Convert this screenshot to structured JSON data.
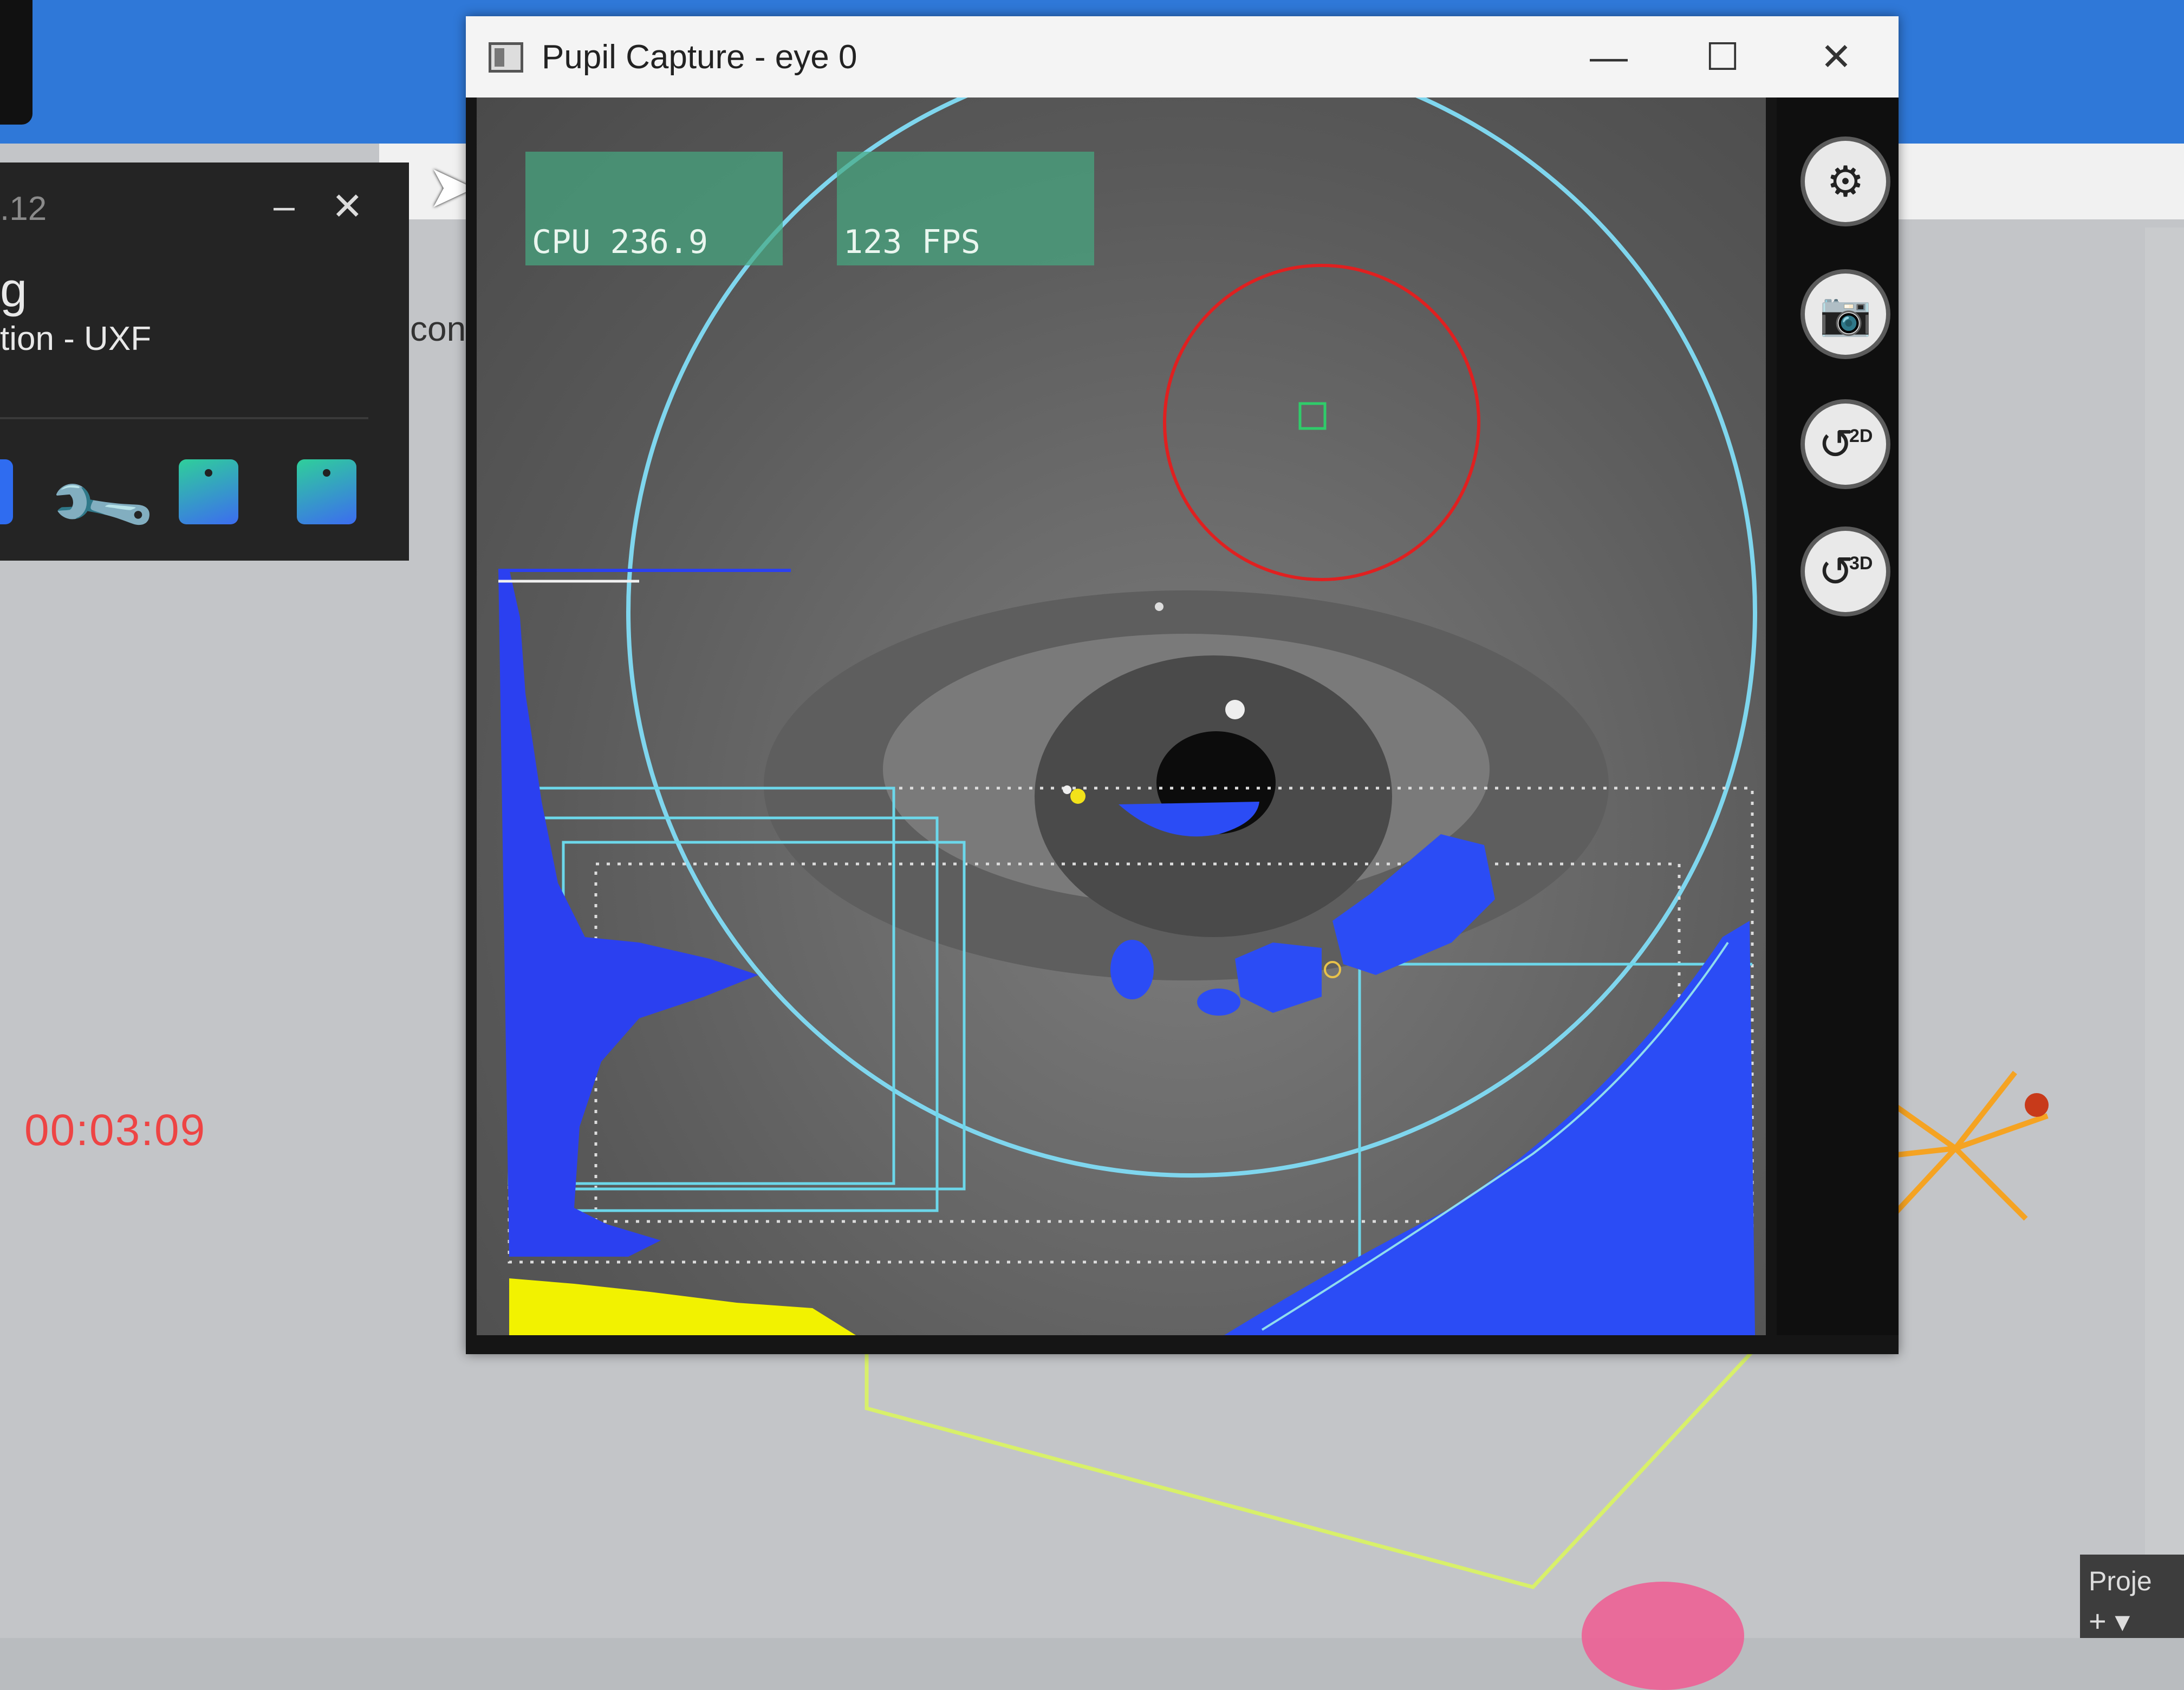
{
  "window": {
    "title": "Pupil Capture - eye 0",
    "minimize_icon": "minimize-icon",
    "maximize_icon": "maximize-icon",
    "close_icon": "close-icon"
  },
  "hud": {
    "cpu_label": "CPU 236.9",
    "fps_label": "123 FPS"
  },
  "toolbar": {
    "settings_icon": "gear-icon",
    "snapshot_icon": "camera-icon",
    "detector_2d_label": "2D",
    "detector_3d_label": "3D"
  },
  "background_app": {
    "panel_title_fragment": ".12",
    "panel_line1_fragment": "g",
    "panel_line2_fragment": "tion - UXF",
    "cont_fragment": "con",
    "timer": "00:03:09",
    "project_label": "Proje",
    "add_label": "+ ▾"
  },
  "colors": {
    "overlay_circle": "#7fd6ee",
    "roi_circle": "#e02020",
    "edges": "#2b4cf5",
    "histogram_bright": "#f2f200",
    "taskbar": "#2f78d8"
  }
}
